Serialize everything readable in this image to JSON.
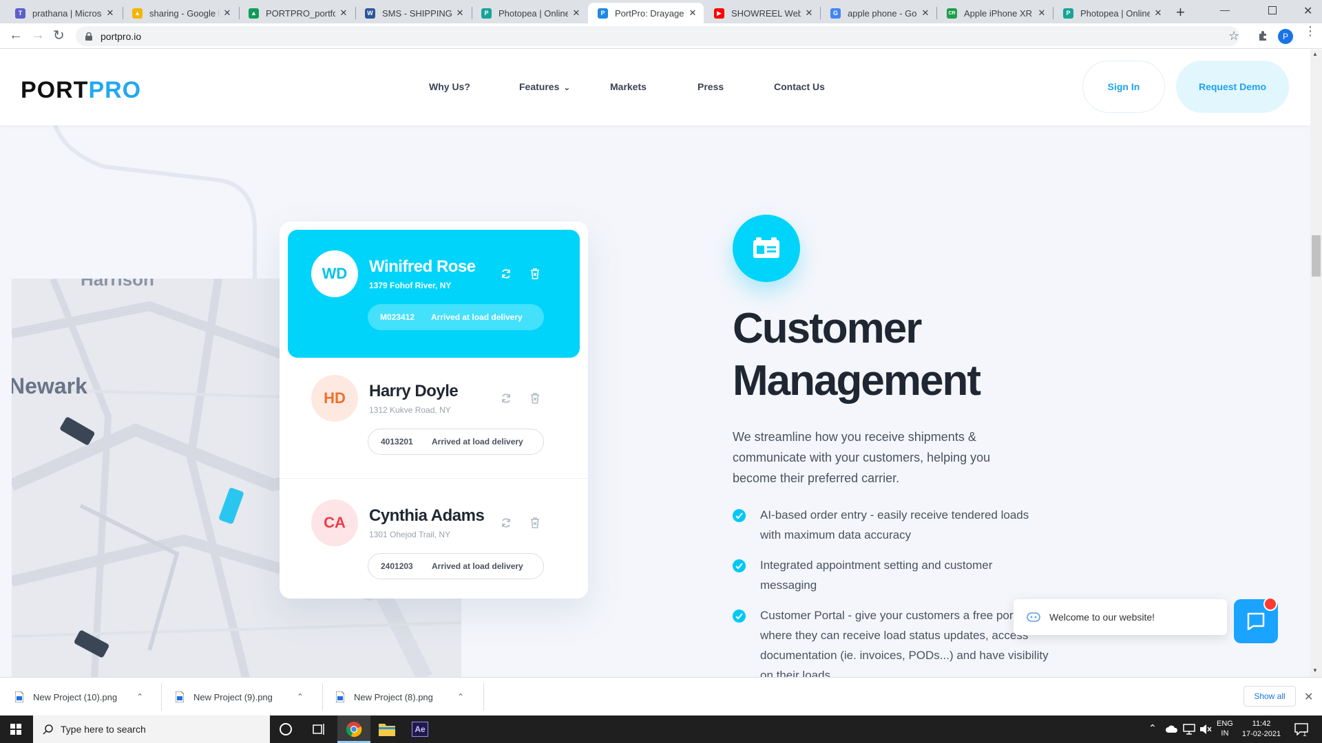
{
  "browser": {
    "tabs": [
      {
        "title": "prathana | Microsof",
        "favicon_color": "#5b5fc7",
        "favicon_letter": "T"
      },
      {
        "title": "sharing - Google Dr",
        "favicon_color": "#f4b400",
        "favicon_letter": "▲"
      },
      {
        "title": "PORTPRO_portfolio",
        "favicon_color": "#0f9d58",
        "favicon_letter": "▲"
      },
      {
        "title": "SMS - SHIPPING MA",
        "favicon_color": "#2b579a",
        "favicon_letter": "W"
      },
      {
        "title": "Photopea | Online P",
        "favicon_color": "#18a497",
        "favicon_letter": "P"
      },
      {
        "title": "PortPro: Drayage Tl",
        "favicon_color": "#1e88e5",
        "favicon_letter": "P"
      },
      {
        "title": "SHOWREEL Web Pro",
        "favicon_color": "#ff0000",
        "favicon_letter": "▶"
      },
      {
        "title": "apple phone - Goog",
        "favicon_color": "#4285f4",
        "favicon_letter": "G"
      },
      {
        "title": "Apple iPhone XR Sm",
        "favicon_color": "#1e9e4a",
        "favicon_letter": "CR"
      },
      {
        "title": "Photopea | Online P",
        "favicon_color": "#18a497",
        "favicon_letter": "P"
      }
    ],
    "close_glyph": "✕",
    "new_tab_glyph": "+",
    "url": "portpro.io",
    "profile_initial": "P"
  },
  "site": {
    "logo_part1": "PORT",
    "logo_part2": "PRO",
    "nav": {
      "why_us": "Why Us?",
      "features": "Features",
      "markets": "Markets",
      "press": "Press",
      "contact": "Contact Us"
    },
    "sign_in": "Sign In",
    "request_demo": "Request Demo"
  },
  "map": {
    "labels": [
      "Newark",
      "Harrison"
    ]
  },
  "customers": [
    {
      "initials": "WD",
      "name": "Winifred Rose",
      "address": "1379 Fohof River, NY",
      "order_id": "M023412",
      "status": "Arrived at load delivery"
    },
    {
      "initials": "HD",
      "name": "Harry Doyle",
      "address": "1312 Kukve Road, NY",
      "order_id": "4013201",
      "status": "Arrived at load delivery"
    },
    {
      "initials": "CA",
      "name": "Cynthia Adams",
      "address": "1301 Ohejod Trail, NY",
      "order_id": "2401203",
      "status": "Arrived at load delivery"
    }
  ],
  "feature": {
    "title_line1": "Customer",
    "title_line2": "Management",
    "description": "We streamline how you receive shipments & communicate with your customers, helping you become their preferred carrier.",
    "bullets": [
      "AI-based order entry - easily receive tendered loads with maximum data accuracy",
      "Integrated appointment setting and customer messaging",
      "Customer Portal - give your customers a free portal where they can receive load status updates, access documentation (ie. invoices, PODs...) and have visibility on their loads"
    ]
  },
  "chat": {
    "welcome": "Welcome to our website!"
  },
  "downloads": {
    "files": [
      "New Project (10).png",
      "New Project (9).png",
      "New Project (8).png"
    ],
    "show_all": "Show all"
  },
  "taskbar": {
    "search_placeholder": "Type here to search",
    "lang_line1": "ENG",
    "lang_line2": "IN",
    "time": "11:42",
    "date": "17-02-2021",
    "notification_count": "1"
  },
  "colors": {
    "accent": "#00d4fb",
    "brand_blue": "#1ea2ee"
  }
}
